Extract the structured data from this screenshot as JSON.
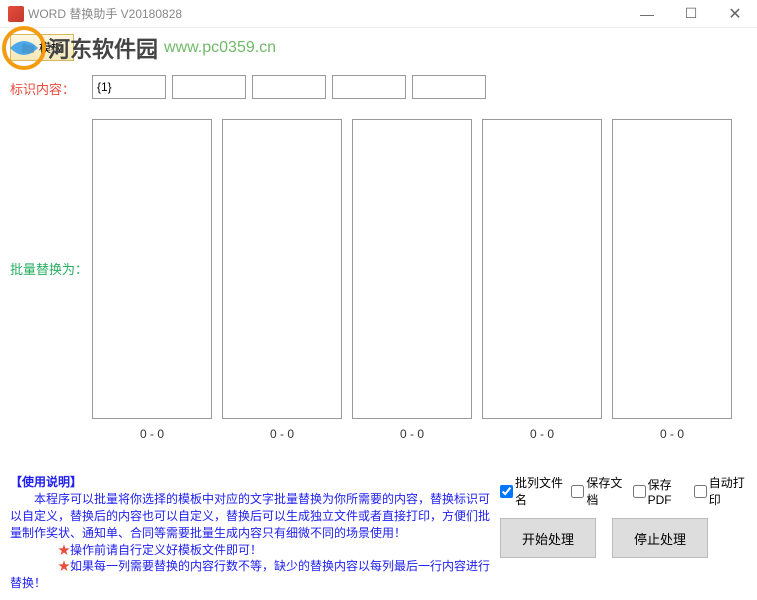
{
  "titlebar": {
    "title": "WORD 替换助手 V20180828",
    "min": "—",
    "max": "☐",
    "close": "✕"
  },
  "watermark": {
    "text_cn": "河东软件园",
    "url": "www.pc0359.cn"
  },
  "toolbar": {
    "template_label": "模板"
  },
  "identify": {
    "label": "标识内容：",
    "values": [
      "{1}",
      "",
      "",
      "",
      ""
    ]
  },
  "replace": {
    "label": "批量替换为：",
    "counters": [
      "0 - 0",
      "0 - 0",
      "0 - 0",
      "0 - 0",
      "0 - 0"
    ]
  },
  "instructions": {
    "title": "【使用说明】",
    "line1": "　　本程序可以批量将你选择的模板中对应的文字批量替换为你所需要的内容，替换标识可以自定义，替换后的内容也可以自定义，替换后可以生成独立文件或者直接打印，方便们批量制作奖状、通知单、合同等需要批量生成内容只有细微不同的场景使用！",
    "star1": "★",
    "line2": "操作前请自行定义好模板文件即可！",
    "star2": "★",
    "line3": "如果每一列需要替换的内容行数不等，缺少的替换内容以每列最后一行内容进行替换！"
  },
  "controls": {
    "check_filename": "批列文件名",
    "check_savedoc": "保存文档",
    "check_savepdf": "保存PDF",
    "check_autoprint": "自动打印",
    "btn_start": "开始处理",
    "btn_stop": "停止处理"
  }
}
